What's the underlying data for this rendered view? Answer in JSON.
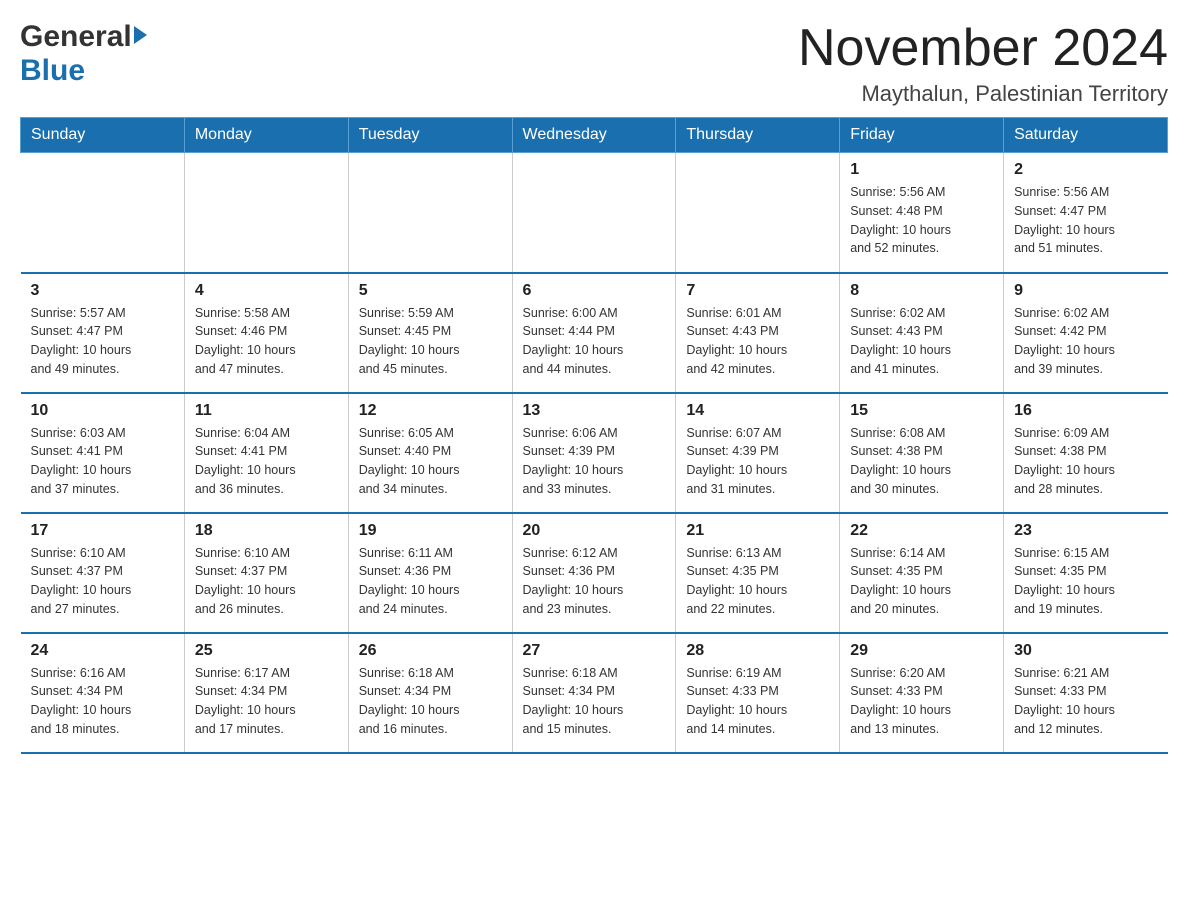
{
  "logo": {
    "general": "General",
    "blue": "Blue"
  },
  "title": "November 2024",
  "location": "Maythalun, Palestinian Territory",
  "weekdays": [
    "Sunday",
    "Monday",
    "Tuesday",
    "Wednesday",
    "Thursday",
    "Friday",
    "Saturday"
  ],
  "weeks": [
    [
      {
        "day": "",
        "info": ""
      },
      {
        "day": "",
        "info": ""
      },
      {
        "day": "",
        "info": ""
      },
      {
        "day": "",
        "info": ""
      },
      {
        "day": "",
        "info": ""
      },
      {
        "day": "1",
        "info": "Sunrise: 5:56 AM\nSunset: 4:48 PM\nDaylight: 10 hours\nand 52 minutes."
      },
      {
        "day": "2",
        "info": "Sunrise: 5:56 AM\nSunset: 4:47 PM\nDaylight: 10 hours\nand 51 minutes."
      }
    ],
    [
      {
        "day": "3",
        "info": "Sunrise: 5:57 AM\nSunset: 4:47 PM\nDaylight: 10 hours\nand 49 minutes."
      },
      {
        "day": "4",
        "info": "Sunrise: 5:58 AM\nSunset: 4:46 PM\nDaylight: 10 hours\nand 47 minutes."
      },
      {
        "day": "5",
        "info": "Sunrise: 5:59 AM\nSunset: 4:45 PM\nDaylight: 10 hours\nand 45 minutes."
      },
      {
        "day": "6",
        "info": "Sunrise: 6:00 AM\nSunset: 4:44 PM\nDaylight: 10 hours\nand 44 minutes."
      },
      {
        "day": "7",
        "info": "Sunrise: 6:01 AM\nSunset: 4:43 PM\nDaylight: 10 hours\nand 42 minutes."
      },
      {
        "day": "8",
        "info": "Sunrise: 6:02 AM\nSunset: 4:43 PM\nDaylight: 10 hours\nand 41 minutes."
      },
      {
        "day": "9",
        "info": "Sunrise: 6:02 AM\nSunset: 4:42 PM\nDaylight: 10 hours\nand 39 minutes."
      }
    ],
    [
      {
        "day": "10",
        "info": "Sunrise: 6:03 AM\nSunset: 4:41 PM\nDaylight: 10 hours\nand 37 minutes."
      },
      {
        "day": "11",
        "info": "Sunrise: 6:04 AM\nSunset: 4:41 PM\nDaylight: 10 hours\nand 36 minutes."
      },
      {
        "day": "12",
        "info": "Sunrise: 6:05 AM\nSunset: 4:40 PM\nDaylight: 10 hours\nand 34 minutes."
      },
      {
        "day": "13",
        "info": "Sunrise: 6:06 AM\nSunset: 4:39 PM\nDaylight: 10 hours\nand 33 minutes."
      },
      {
        "day": "14",
        "info": "Sunrise: 6:07 AM\nSunset: 4:39 PM\nDaylight: 10 hours\nand 31 minutes."
      },
      {
        "day": "15",
        "info": "Sunrise: 6:08 AM\nSunset: 4:38 PM\nDaylight: 10 hours\nand 30 minutes."
      },
      {
        "day": "16",
        "info": "Sunrise: 6:09 AM\nSunset: 4:38 PM\nDaylight: 10 hours\nand 28 minutes."
      }
    ],
    [
      {
        "day": "17",
        "info": "Sunrise: 6:10 AM\nSunset: 4:37 PM\nDaylight: 10 hours\nand 27 minutes."
      },
      {
        "day": "18",
        "info": "Sunrise: 6:10 AM\nSunset: 4:37 PM\nDaylight: 10 hours\nand 26 minutes."
      },
      {
        "day": "19",
        "info": "Sunrise: 6:11 AM\nSunset: 4:36 PM\nDaylight: 10 hours\nand 24 minutes."
      },
      {
        "day": "20",
        "info": "Sunrise: 6:12 AM\nSunset: 4:36 PM\nDaylight: 10 hours\nand 23 minutes."
      },
      {
        "day": "21",
        "info": "Sunrise: 6:13 AM\nSunset: 4:35 PM\nDaylight: 10 hours\nand 22 minutes."
      },
      {
        "day": "22",
        "info": "Sunrise: 6:14 AM\nSunset: 4:35 PM\nDaylight: 10 hours\nand 20 minutes."
      },
      {
        "day": "23",
        "info": "Sunrise: 6:15 AM\nSunset: 4:35 PM\nDaylight: 10 hours\nand 19 minutes."
      }
    ],
    [
      {
        "day": "24",
        "info": "Sunrise: 6:16 AM\nSunset: 4:34 PM\nDaylight: 10 hours\nand 18 minutes."
      },
      {
        "day": "25",
        "info": "Sunrise: 6:17 AM\nSunset: 4:34 PM\nDaylight: 10 hours\nand 17 minutes."
      },
      {
        "day": "26",
        "info": "Sunrise: 6:18 AM\nSunset: 4:34 PM\nDaylight: 10 hours\nand 16 minutes."
      },
      {
        "day": "27",
        "info": "Sunrise: 6:18 AM\nSunset: 4:34 PM\nDaylight: 10 hours\nand 15 minutes."
      },
      {
        "day": "28",
        "info": "Sunrise: 6:19 AM\nSunset: 4:33 PM\nDaylight: 10 hours\nand 14 minutes."
      },
      {
        "day": "29",
        "info": "Sunrise: 6:20 AM\nSunset: 4:33 PM\nDaylight: 10 hours\nand 13 minutes."
      },
      {
        "day": "30",
        "info": "Sunrise: 6:21 AM\nSunset: 4:33 PM\nDaylight: 10 hours\nand 12 minutes."
      }
    ]
  ]
}
